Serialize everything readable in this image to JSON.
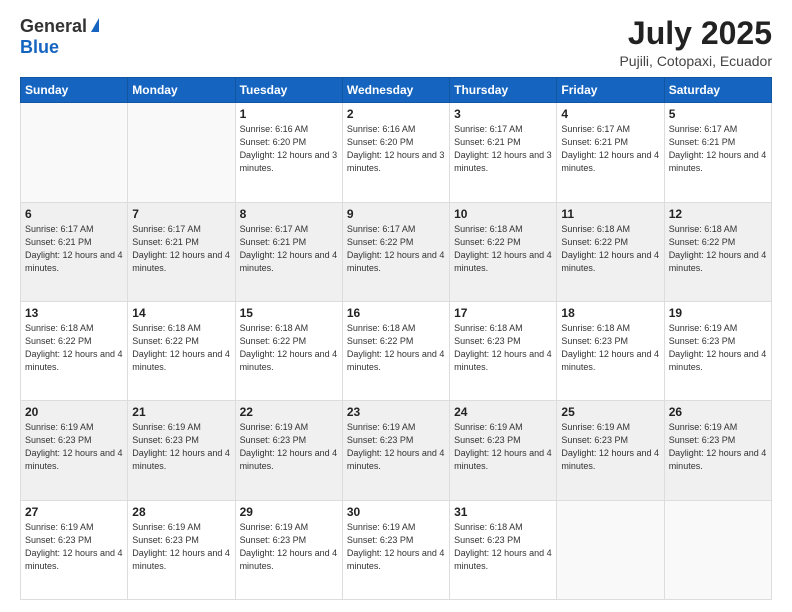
{
  "header": {
    "logo_general": "General",
    "logo_blue": "Blue",
    "month_title": "July 2025",
    "location": "Pujili, Cotopaxi, Ecuador"
  },
  "weekdays": [
    "Sunday",
    "Monday",
    "Tuesday",
    "Wednesday",
    "Thursday",
    "Friday",
    "Saturday"
  ],
  "weeks": [
    [
      {
        "day": "",
        "sunrise": "",
        "sunset": "",
        "daylight": ""
      },
      {
        "day": "",
        "sunrise": "",
        "sunset": "",
        "daylight": ""
      },
      {
        "day": "1",
        "sunrise": "Sunrise: 6:16 AM",
        "sunset": "Sunset: 6:20 PM",
        "daylight": "Daylight: 12 hours and 3 minutes."
      },
      {
        "day": "2",
        "sunrise": "Sunrise: 6:16 AM",
        "sunset": "Sunset: 6:20 PM",
        "daylight": "Daylight: 12 hours and 3 minutes."
      },
      {
        "day": "3",
        "sunrise": "Sunrise: 6:17 AM",
        "sunset": "Sunset: 6:21 PM",
        "daylight": "Daylight: 12 hours and 3 minutes."
      },
      {
        "day": "4",
        "sunrise": "Sunrise: 6:17 AM",
        "sunset": "Sunset: 6:21 PM",
        "daylight": "Daylight: 12 hours and 4 minutes."
      },
      {
        "day": "5",
        "sunrise": "Sunrise: 6:17 AM",
        "sunset": "Sunset: 6:21 PM",
        "daylight": "Daylight: 12 hours and 4 minutes."
      }
    ],
    [
      {
        "day": "6",
        "sunrise": "Sunrise: 6:17 AM",
        "sunset": "Sunset: 6:21 PM",
        "daylight": "Daylight: 12 hours and 4 minutes."
      },
      {
        "day": "7",
        "sunrise": "Sunrise: 6:17 AM",
        "sunset": "Sunset: 6:21 PM",
        "daylight": "Daylight: 12 hours and 4 minutes."
      },
      {
        "day": "8",
        "sunrise": "Sunrise: 6:17 AM",
        "sunset": "Sunset: 6:21 PM",
        "daylight": "Daylight: 12 hours and 4 minutes."
      },
      {
        "day": "9",
        "sunrise": "Sunrise: 6:17 AM",
        "sunset": "Sunset: 6:22 PM",
        "daylight": "Daylight: 12 hours and 4 minutes."
      },
      {
        "day": "10",
        "sunrise": "Sunrise: 6:18 AM",
        "sunset": "Sunset: 6:22 PM",
        "daylight": "Daylight: 12 hours and 4 minutes."
      },
      {
        "day": "11",
        "sunrise": "Sunrise: 6:18 AM",
        "sunset": "Sunset: 6:22 PM",
        "daylight": "Daylight: 12 hours and 4 minutes."
      },
      {
        "day": "12",
        "sunrise": "Sunrise: 6:18 AM",
        "sunset": "Sunset: 6:22 PM",
        "daylight": "Daylight: 12 hours and 4 minutes."
      }
    ],
    [
      {
        "day": "13",
        "sunrise": "Sunrise: 6:18 AM",
        "sunset": "Sunset: 6:22 PM",
        "daylight": "Daylight: 12 hours and 4 minutes."
      },
      {
        "day": "14",
        "sunrise": "Sunrise: 6:18 AM",
        "sunset": "Sunset: 6:22 PM",
        "daylight": "Daylight: 12 hours and 4 minutes."
      },
      {
        "day": "15",
        "sunrise": "Sunrise: 6:18 AM",
        "sunset": "Sunset: 6:22 PM",
        "daylight": "Daylight: 12 hours and 4 minutes."
      },
      {
        "day": "16",
        "sunrise": "Sunrise: 6:18 AM",
        "sunset": "Sunset: 6:22 PM",
        "daylight": "Daylight: 12 hours and 4 minutes."
      },
      {
        "day": "17",
        "sunrise": "Sunrise: 6:18 AM",
        "sunset": "Sunset: 6:23 PM",
        "daylight": "Daylight: 12 hours and 4 minutes."
      },
      {
        "day": "18",
        "sunrise": "Sunrise: 6:18 AM",
        "sunset": "Sunset: 6:23 PM",
        "daylight": "Daylight: 12 hours and 4 minutes."
      },
      {
        "day": "19",
        "sunrise": "Sunrise: 6:19 AM",
        "sunset": "Sunset: 6:23 PM",
        "daylight": "Daylight: 12 hours and 4 minutes."
      }
    ],
    [
      {
        "day": "20",
        "sunrise": "Sunrise: 6:19 AM",
        "sunset": "Sunset: 6:23 PM",
        "daylight": "Daylight: 12 hours and 4 minutes."
      },
      {
        "day": "21",
        "sunrise": "Sunrise: 6:19 AM",
        "sunset": "Sunset: 6:23 PM",
        "daylight": "Daylight: 12 hours and 4 minutes."
      },
      {
        "day": "22",
        "sunrise": "Sunrise: 6:19 AM",
        "sunset": "Sunset: 6:23 PM",
        "daylight": "Daylight: 12 hours and 4 minutes."
      },
      {
        "day": "23",
        "sunrise": "Sunrise: 6:19 AM",
        "sunset": "Sunset: 6:23 PM",
        "daylight": "Daylight: 12 hours and 4 minutes."
      },
      {
        "day": "24",
        "sunrise": "Sunrise: 6:19 AM",
        "sunset": "Sunset: 6:23 PM",
        "daylight": "Daylight: 12 hours and 4 minutes."
      },
      {
        "day": "25",
        "sunrise": "Sunrise: 6:19 AM",
        "sunset": "Sunset: 6:23 PM",
        "daylight": "Daylight: 12 hours and 4 minutes."
      },
      {
        "day": "26",
        "sunrise": "Sunrise: 6:19 AM",
        "sunset": "Sunset: 6:23 PM",
        "daylight": "Daylight: 12 hours and 4 minutes."
      }
    ],
    [
      {
        "day": "27",
        "sunrise": "Sunrise: 6:19 AM",
        "sunset": "Sunset: 6:23 PM",
        "daylight": "Daylight: 12 hours and 4 minutes."
      },
      {
        "day": "28",
        "sunrise": "Sunrise: 6:19 AM",
        "sunset": "Sunset: 6:23 PM",
        "daylight": "Daylight: 12 hours and 4 minutes."
      },
      {
        "day": "29",
        "sunrise": "Sunrise: 6:19 AM",
        "sunset": "Sunset: 6:23 PM",
        "daylight": "Daylight: 12 hours and 4 minutes."
      },
      {
        "day": "30",
        "sunrise": "Sunrise: 6:19 AM",
        "sunset": "Sunset: 6:23 PM",
        "daylight": "Daylight: 12 hours and 4 minutes."
      },
      {
        "day": "31",
        "sunrise": "Sunrise: 6:18 AM",
        "sunset": "Sunset: 6:23 PM",
        "daylight": "Daylight: 12 hours and 4 minutes."
      },
      {
        "day": "",
        "sunrise": "",
        "sunset": "",
        "daylight": ""
      },
      {
        "day": "",
        "sunrise": "",
        "sunset": "",
        "daylight": ""
      }
    ]
  ]
}
